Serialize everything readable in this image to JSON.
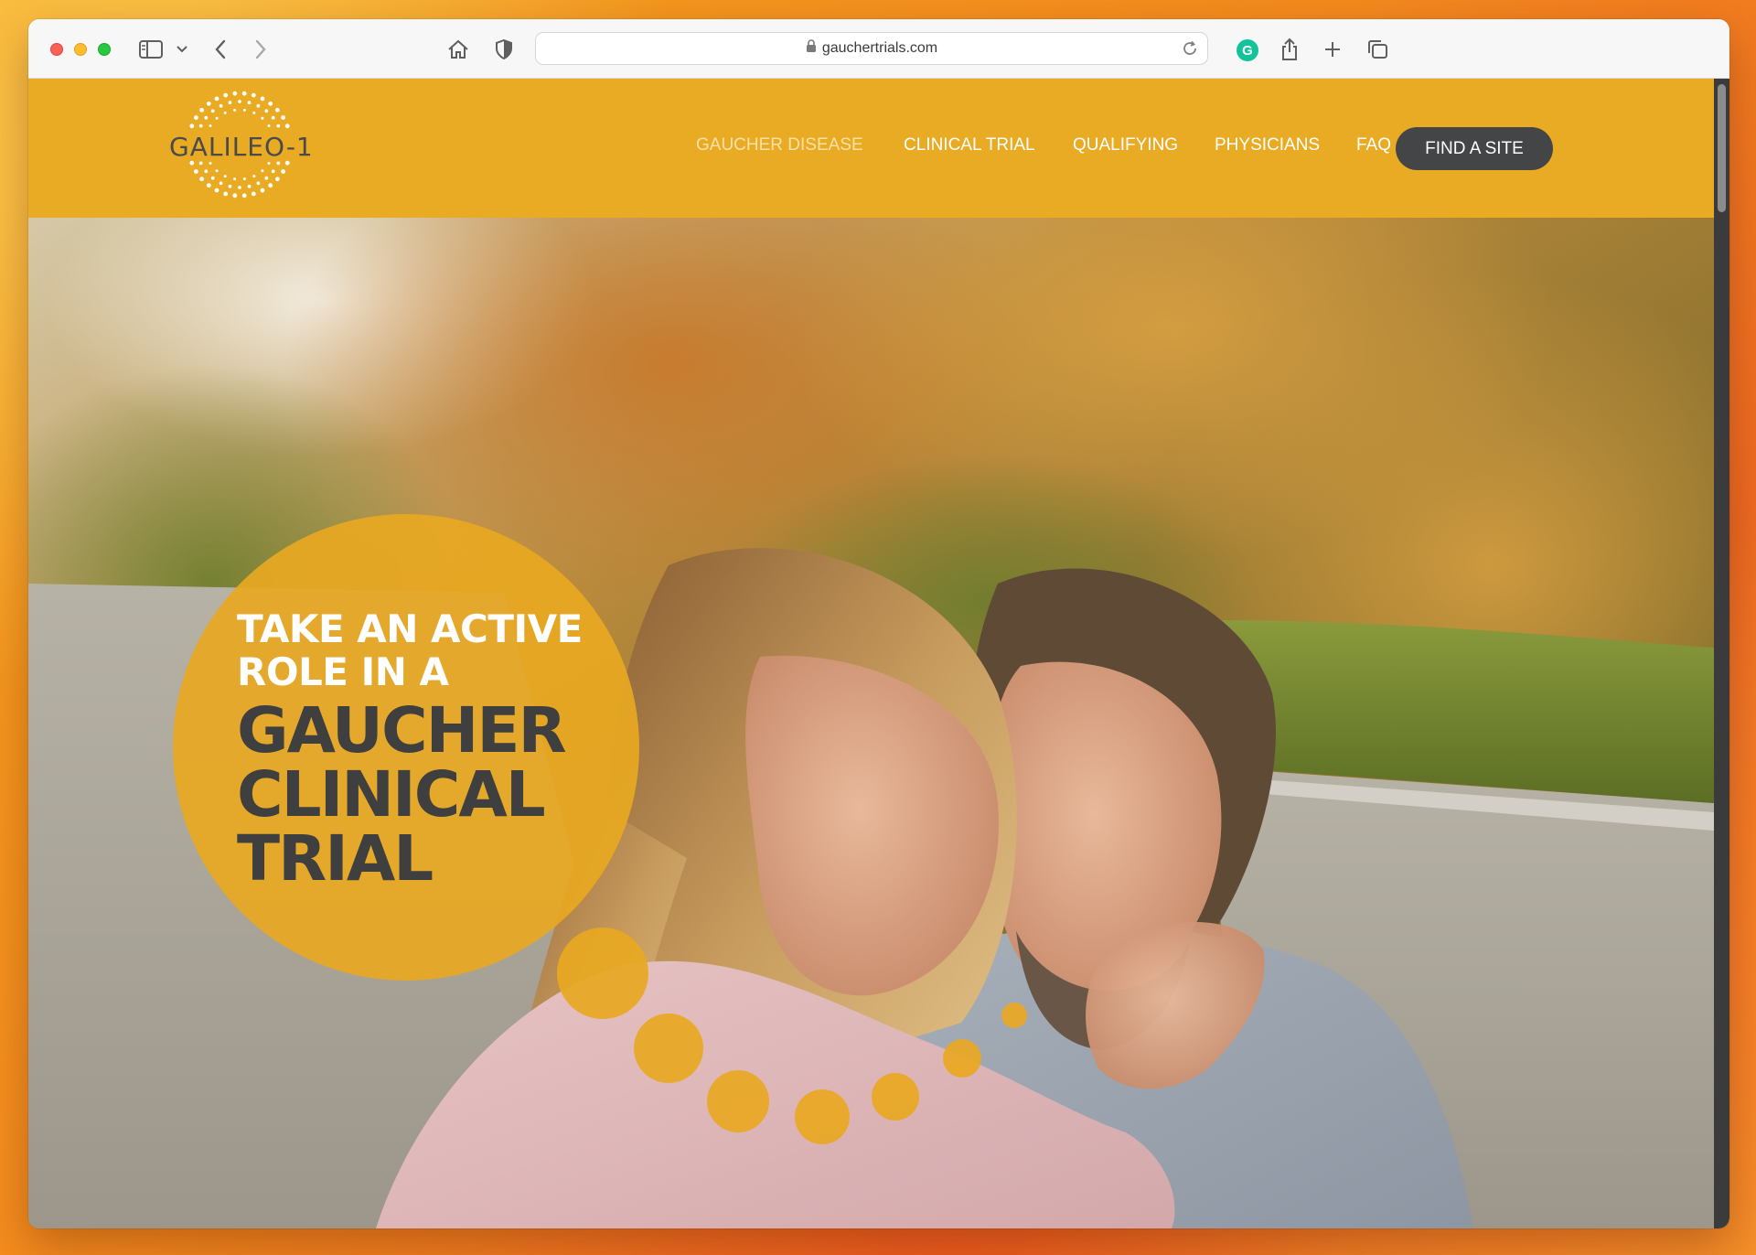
{
  "browser": {
    "url": "gauchertrials.com",
    "grammarly_letter": "G",
    "icons": {
      "sidebar": "sidebar-icon",
      "chevron": "chevron-down-icon",
      "back": "back-arrow-icon",
      "forward": "forward-arrow-icon",
      "home": "home-icon",
      "privacy": "shield-icon",
      "lock": "lock-icon",
      "reload": "reload-icon",
      "share": "share-icon",
      "new_tab": "plus-icon",
      "tabs": "tab-overview-icon"
    }
  },
  "site": {
    "logo_text": "GALILEO-1",
    "nav": [
      {
        "label": "GAUCHER DISEASE",
        "active": true
      },
      {
        "label": "CLINICAL TRIAL",
        "active": false
      },
      {
        "label": "QUALIFYING",
        "active": false
      },
      {
        "label": "PHYSICIANS",
        "active": false
      },
      {
        "label": "FAQ",
        "active": false
      }
    ],
    "cta_label": "FIND A SITE",
    "hero": {
      "line1": "TAKE AN ACTIVE",
      "line2": "ROLE IN A",
      "line3": "GAUCHER",
      "line4": "CLINICAL",
      "line5": "TRIAL"
    },
    "colors": {
      "brand_gold": "#e9ab24",
      "dark_gray": "#444547",
      "nav_active": "#fbe1a8"
    }
  }
}
